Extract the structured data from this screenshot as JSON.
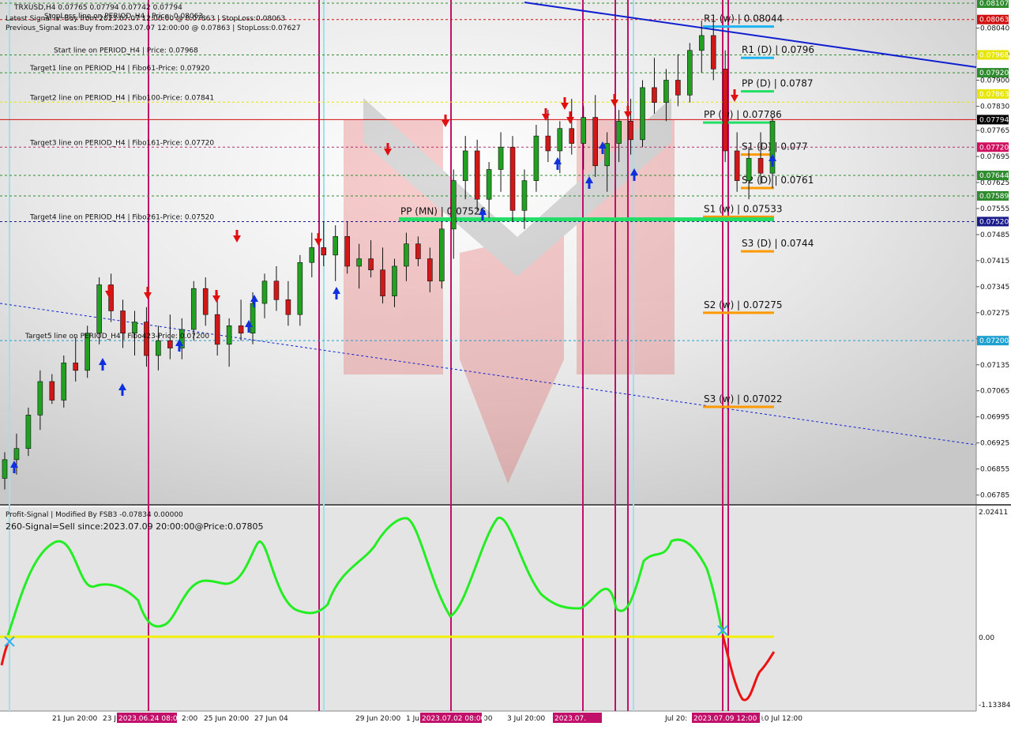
{
  "header": {
    "symbol_line": "TRXUSD,H4  0.07765 0.07794 0.07742 0.07794",
    "stoploss_line": "StopLoss line on PERIOD_H4 | Price: 0.08063",
    "latest_signal": "Latest Signal is: Buy from:2023.07.07 12:00:00 @ 0.07863 | StopLoss:0.08063",
    "previous_signal": "Previous_Signal was:Buy from:2023.07.07 12:00:00 @ 0.07863 | StopLoss:0.07627"
  },
  "target_lines": [
    {
      "label": "Start line on PERIOD_H4 | Price: 0.07968",
      "price": 0.07968,
      "color": "#2e8b2e"
    },
    {
      "label": "Target1 line on PERIOD_H4 | Fibo61-Price: 0.07920",
      "price": 0.0792,
      "color": "#2e8b2e"
    },
    {
      "label": "Target2 line on PERIOD_H4 | Fibo100-Price: 0.07841",
      "price": 0.07841,
      "color": "#e6e600"
    },
    {
      "label": "Target3 line on PERIOD_H4 | Fibo161-Price: 0.07720",
      "price": 0.0772,
      "color": "#b0306a"
    },
    {
      "label": "Target4 line on PERIOD_H4 | Fibo261-Price: 0.07520",
      "price": 0.0752,
      "color": "#1a1a8a"
    },
    {
      "label": "Target5 line on PERIOD_H4 | Fibo423-Price: 0.07200",
      "price": 0.072,
      "color": "#1ea0d0"
    }
  ],
  "pivots": [
    {
      "label": "R1 (w) | 0.08044",
      "price": 0.08044,
      "color": "#1eb4f0",
      "side": "w"
    },
    {
      "label": "R1 (D) | 0.0796",
      "price": 0.0796,
      "color": "#1eb4f0",
      "side": "d"
    },
    {
      "label": "PP (D) | 0.0787",
      "price": 0.0787,
      "color": "#22dd66",
      "side": "d"
    },
    {
      "label": "PP (w) | 0.07786",
      "price": 0.07786,
      "color": "#22dd66",
      "side": "w"
    },
    {
      "label": "S1 (D) | 0.077",
      "price": 0.077,
      "color": "#ff9900",
      "side": "d"
    },
    {
      "label": "S2 (D) | 0.0761",
      "price": 0.0761,
      "color": "#ff9900",
      "side": "d"
    },
    {
      "label": "S1 (w) | 0.07533",
      "price": 0.07533,
      "color": "#ff9900",
      "side": "w"
    },
    {
      "label": "S3 (D) | 0.0744",
      "price": 0.0744,
      "color": "#ff9900",
      "side": "d"
    },
    {
      "label": "S2 (w) | 0.07275",
      "price": 0.07275,
      "color": "#ff9900",
      "side": "w"
    },
    {
      "label": "S3 (w) | 0.07022",
      "price": 0.07022,
      "color": "#ff9900",
      "side": "w"
    },
    {
      "label": "PP (MN) | 0.07526",
      "price": 0.07526,
      "color": "#22dd66",
      "side": "mn"
    }
  ],
  "price_tags": [
    {
      "text": "0.08107",
      "price": 0.08107,
      "bg": "#2e8b2e",
      "fg": "#ffffff"
    },
    {
      "text": "0.08063",
      "price": 0.08063,
      "bg": "#d01010",
      "fg": "#ffffff"
    },
    {
      "text": "0.07968",
      "price": 0.07968,
      "bg": "#e6e600",
      "fg": "#ffffff"
    },
    {
      "text": "0.07920",
      "price": 0.0792,
      "bg": "#2e8b2e",
      "fg": "#ffffff"
    },
    {
      "text": "0.07863",
      "price": 0.07863,
      "bg": "#e6e600",
      "fg": "#ffffff"
    },
    {
      "text": "0.07794",
      "price": 0.07794,
      "bg": "#000000",
      "fg": "#ffffff"
    },
    {
      "text": "0.07720",
      "price": 0.0772,
      "bg": "#d01060",
      "fg": "#ffffff"
    },
    {
      "text": "0.07644",
      "price": 0.07644,
      "bg": "#2e8b2e",
      "fg": "#ffffff"
    },
    {
      "text": "0.07589",
      "price": 0.07589,
      "bg": "#2e8b2e",
      "fg": "#ffffff"
    },
    {
      "text": "0.07520",
      "price": 0.0752,
      "bg": "#1a1a8a",
      "fg": "#ffffff"
    },
    {
      "text": "0.07200",
      "price": 0.072,
      "bg": "#1ea0d0",
      "fg": "#ffffff"
    }
  ],
  "price_axis_ticks": [
    "0.08040",
    "0.07970",
    "0.07900",
    "0.07830",
    "0.07765",
    "0.07695",
    "0.07625",
    "0.07555",
    "0.07485",
    "0.07415",
    "0.07345",
    "0.07275",
    "0.07205",
    "0.07135",
    "0.07065",
    "0.06995",
    "0.06925",
    "0.06855",
    "0.06785"
  ],
  "time_axis_labels": [
    "21 Jun 20:00",
    "23 J",
    "2:00",
    "25 Jun 20:00",
    "27 Jun 04",
    "29 Jun 20:00",
    "1 Ju",
    "00",
    "3 Jul 20:00",
    "Jul 20:",
    "10 Jul 12:00"
  ],
  "time_highlights": [
    "2023.06.24 08:00",
    "2023.07.02 08:00",
    "2023.07.",
    "2023.07.09 12:00 0"
  ],
  "indicator": {
    "title": "Profit-Signal | Modified By FSB3 -0.07834 0.00000",
    "signal": "260-Signal=Sell since:2023.07.09 20:00:00@Price:0.07805",
    "axis_ticks": [
      "2.02411",
      "0.00",
      "-1.13384"
    ]
  },
  "chart_data": {
    "type": "candlestick",
    "symbol": "TRXUSD",
    "timeframe": "H4",
    "ylim": [
      0.06765,
      0.08107
    ],
    "candles": [
      [
        0.0683,
        0.069,
        0.068,
        0.0688
      ],
      [
        0.0688,
        0.0695,
        0.0684,
        0.0691
      ],
      [
        0.0691,
        0.0702,
        0.0689,
        0.07
      ],
      [
        0.07,
        0.0712,
        0.0696,
        0.0709
      ],
      [
        0.0709,
        0.0711,
        0.0703,
        0.0704
      ],
      [
        0.0704,
        0.0716,
        0.0702,
        0.0714
      ],
      [
        0.0714,
        0.0721,
        0.0709,
        0.0712
      ],
      [
        0.0712,
        0.0724,
        0.071,
        0.0722
      ],
      [
        0.0722,
        0.0737,
        0.0719,
        0.0735
      ],
      [
        0.0735,
        0.0738,
        0.0725,
        0.0728
      ],
      [
        0.0728,
        0.0731,
        0.0718,
        0.0722
      ],
      [
        0.0722,
        0.0728,
        0.0716,
        0.0725
      ],
      [
        0.0725,
        0.0729,
        0.0713,
        0.0716
      ],
      [
        0.0716,
        0.0724,
        0.0712,
        0.072
      ],
      [
        0.072,
        0.0727,
        0.0715,
        0.0718
      ],
      [
        0.0718,
        0.0726,
        0.0715,
        0.0723
      ],
      [
        0.0723,
        0.0736,
        0.072,
        0.0734
      ],
      [
        0.0734,
        0.0737,
        0.0724,
        0.0727
      ],
      [
        0.0727,
        0.0733,
        0.0716,
        0.0719
      ],
      [
        0.0719,
        0.0726,
        0.0713,
        0.0724
      ],
      [
        0.0724,
        0.0731,
        0.072,
        0.0722
      ],
      [
        0.0722,
        0.0733,
        0.0719,
        0.073
      ],
      [
        0.073,
        0.0738,
        0.0726,
        0.0736
      ],
      [
        0.0736,
        0.074,
        0.0728,
        0.0731
      ],
      [
        0.0731,
        0.0736,
        0.0724,
        0.0727
      ],
      [
        0.0727,
        0.0743,
        0.0724,
        0.0741
      ],
      [
        0.0741,
        0.0749,
        0.0737,
        0.0745
      ],
      [
        0.0745,
        0.0752,
        0.074,
        0.0743
      ],
      [
        0.0743,
        0.0751,
        0.0736,
        0.0748
      ],
      [
        0.0748,
        0.0752,
        0.0738,
        0.074
      ],
      [
        0.074,
        0.0746,
        0.0734,
        0.0742
      ],
      [
        0.0742,
        0.0747,
        0.0737,
        0.0739
      ],
      [
        0.0739,
        0.0745,
        0.073,
        0.0732
      ],
      [
        0.0732,
        0.0742,
        0.0729,
        0.074
      ],
      [
        0.074,
        0.0749,
        0.0736,
        0.0746
      ],
      [
        0.0746,
        0.0748,
        0.074,
        0.0742
      ],
      [
        0.0742,
        0.0745,
        0.0733,
        0.0736
      ],
      [
        0.0736,
        0.0752,
        0.0734,
        0.075
      ],
      [
        0.075,
        0.0766,
        0.0742,
        0.0763
      ],
      [
        0.0763,
        0.0775,
        0.0758,
        0.0771
      ],
      [
        0.0771,
        0.0774,
        0.0755,
        0.0758
      ],
      [
        0.0758,
        0.0768,
        0.0753,
        0.0766
      ],
      [
        0.0766,
        0.0776,
        0.076,
        0.0772
      ],
      [
        0.0772,
        0.0775,
        0.0752,
        0.0755
      ],
      [
        0.0755,
        0.0766,
        0.075,
        0.0763
      ],
      [
        0.0763,
        0.0778,
        0.076,
        0.0775
      ],
      [
        0.0775,
        0.0782,
        0.0768,
        0.0771
      ],
      [
        0.0771,
        0.0779,
        0.0765,
        0.0777
      ],
      [
        0.0777,
        0.0785,
        0.077,
        0.0773
      ],
      [
        0.0773,
        0.0783,
        0.0766,
        0.078
      ],
      [
        0.078,
        0.0786,
        0.0764,
        0.0767
      ],
      [
        0.0767,
        0.0776,
        0.076,
        0.0773
      ],
      [
        0.0773,
        0.0782,
        0.0768,
        0.0779
      ],
      [
        0.0779,
        0.0785,
        0.077,
        0.0774
      ],
      [
        0.0774,
        0.079,
        0.0772,
        0.0788
      ],
      [
        0.0788,
        0.0796,
        0.0781,
        0.0784
      ],
      [
        0.0784,
        0.0793,
        0.0779,
        0.079
      ],
      [
        0.079,
        0.0797,
        0.0783,
        0.0786
      ],
      [
        0.0786,
        0.08,
        0.0784,
        0.0798
      ],
      [
        0.0798,
        0.0806,
        0.0792,
        0.0802
      ],
      [
        0.0802,
        0.0806,
        0.079,
        0.0793
      ],
      [
        0.0793,
        0.0798,
        0.0768,
        0.0771
      ],
      [
        0.0771,
        0.0776,
        0.076,
        0.0763
      ],
      [
        0.0763,
        0.0772,
        0.0758,
        0.0769
      ],
      [
        0.0769,
        0.0776,
        0.0762,
        0.0765
      ],
      [
        0.0765,
        0.078,
        0.0761,
        0.0779
      ]
    ]
  }
}
